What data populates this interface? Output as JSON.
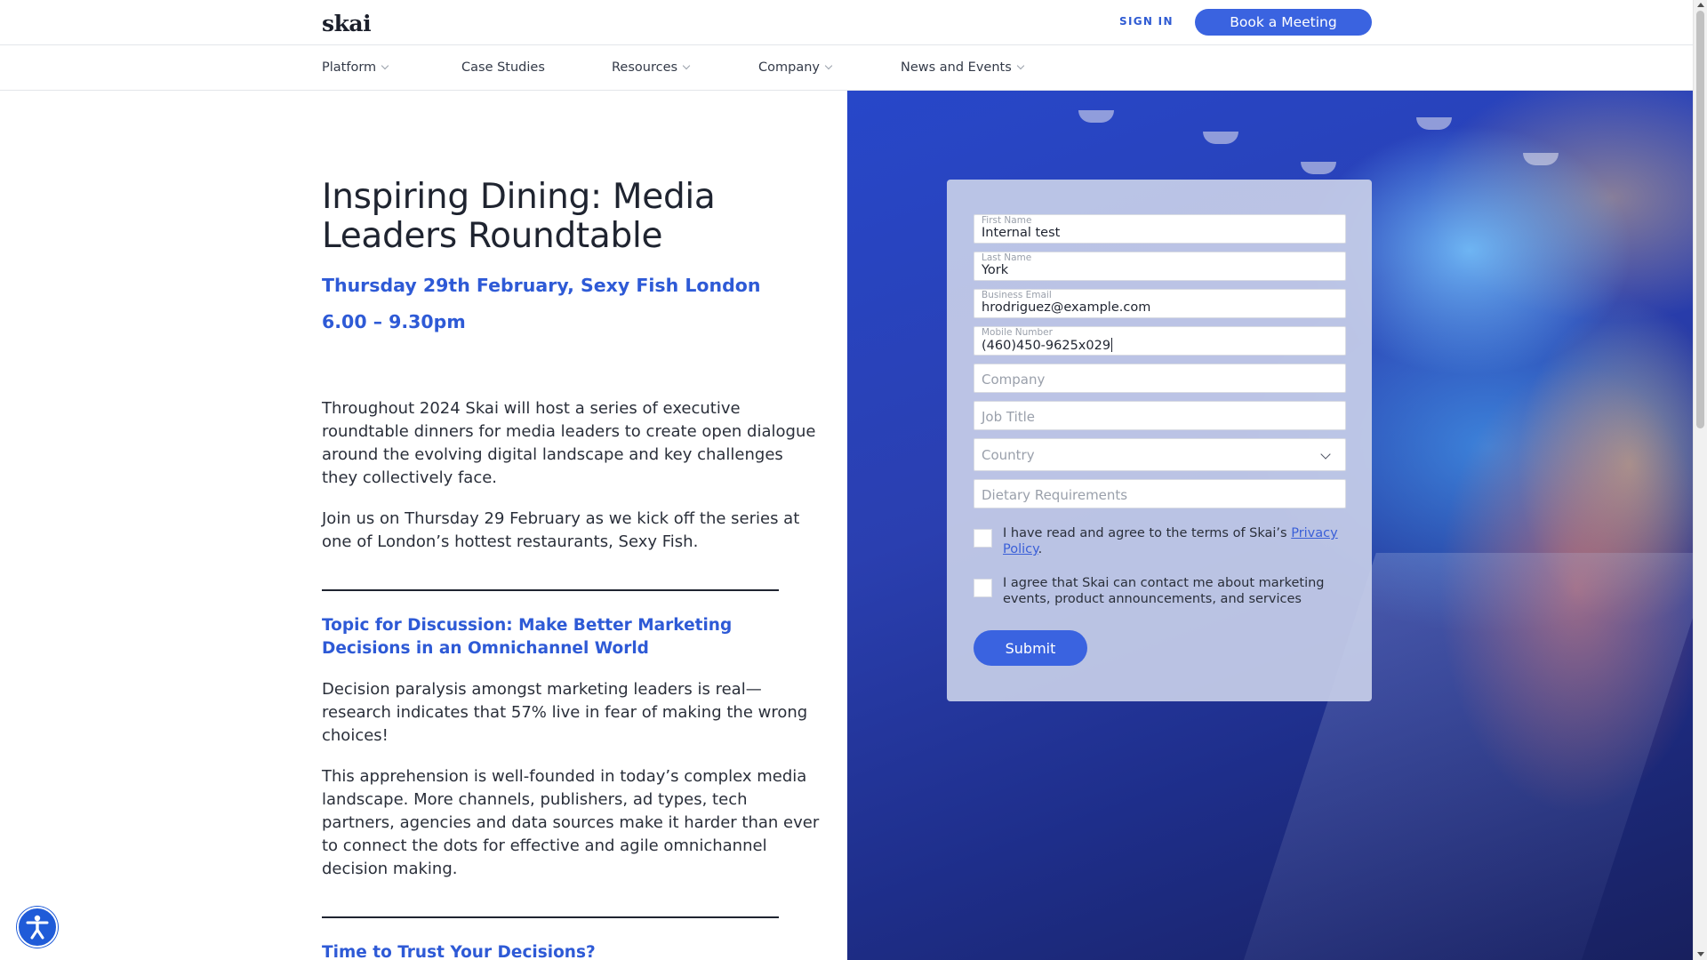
{
  "header": {
    "logo": "skai",
    "signin_label": "SIGN IN",
    "book_label": "Book a Meeting"
  },
  "nav": {
    "items": [
      {
        "label": "Platform",
        "has_dropdown": true
      },
      {
        "label": "Case Studies",
        "has_dropdown": false
      },
      {
        "label": "Resources",
        "has_dropdown": true
      },
      {
        "label": "Company",
        "has_dropdown": true
      },
      {
        "label": "News and Events",
        "has_dropdown": true
      }
    ]
  },
  "article": {
    "title": "Inspiring Dining: Media Leaders Roundtable",
    "date_line": "Thursday 29th February, Sexy Fish London",
    "time_line": "6.00 – 9.30pm",
    "intro": "Throughout 2024 Skai will host a series of executive roundtable dinners for media leaders to create open dialogue around the evolving digital landscape and key challenges they collectively face.",
    "join": "Join us on Thursday 29 February as we kick off the series at one of London’s hottest restaurants, Sexy Fish.",
    "topic_heading": "Topic for Discussion: Make Better Marketing Decisions in an Omnichannel World",
    "topic_p1": "Decision paralysis amongst marketing leaders is real—research indicates that 57% live in fear of making the wrong choices!",
    "topic_p2": "This apprehension is well-founded in today’s complex media landscape. More channels, publishers, ad types, tech partners, agencies and data sources make it harder than ever to connect the dots for effective and agile omnichannel decision making.",
    "trust_heading": "Time to Trust Your Decisions?"
  },
  "form": {
    "first_name": {
      "label": "First Name",
      "value": "Internal test"
    },
    "last_name": {
      "label": "Last Name",
      "value": "York"
    },
    "email": {
      "label": "Business Email",
      "value": "hrodriguez@example.com"
    },
    "mobile": {
      "label": "Mobile Number",
      "value": "(460)450-9625x029"
    },
    "company_placeholder": "Company",
    "job_title_placeholder": "Job Title",
    "country_placeholder": "Country",
    "dietary_placeholder": "Dietary Requirements",
    "privacy_text_before": "I have read and agree to the terms of Skai’s ",
    "privacy_link": "Privacy Policy",
    "privacy_text_after": ".",
    "marketing_text": "I agree that Skai can contact me about marketing events, product announcements, and services",
    "submit_label": "Submit"
  },
  "colors": {
    "accent": "#3a63e0",
    "heading_blue": "#2e5ad6",
    "text": "#1f2430"
  }
}
